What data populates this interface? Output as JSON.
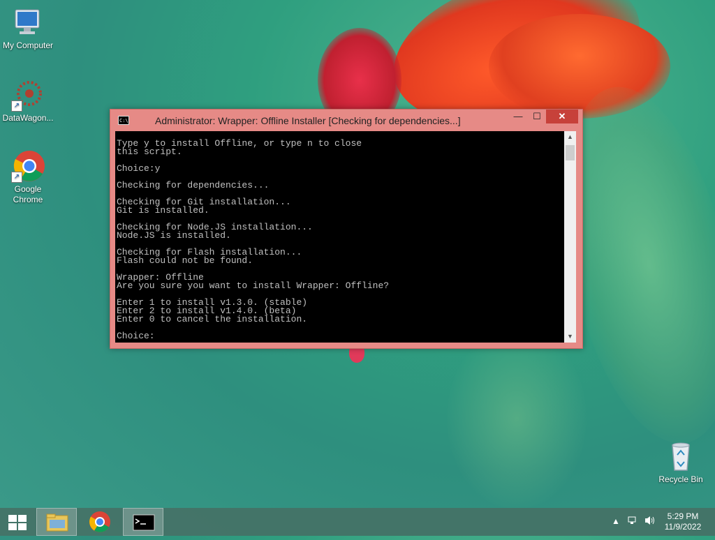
{
  "desktop": {
    "icons": [
      {
        "label": "My Computer",
        "icon": "computer-icon"
      },
      {
        "label": "DataWagon...",
        "icon": "datawagon-icon"
      },
      {
        "label": "Google Chrome",
        "icon": "chrome-icon"
      },
      {
        "label": "Recycle Bin",
        "icon": "recycle-bin-icon"
      }
    ]
  },
  "window": {
    "title": "Administrator:  Wrapper: Offline Installer [Checking for dependencies...]",
    "minimize_glyph": "—",
    "maximize_glyph": "☐",
    "close_glyph": "✕",
    "console_text": "Type y to install Offline, or type n to close\nthis script.\n\nChoice:y\n\nChecking for dependencies...\n\nChecking for Git installation...\nGit is installed.\n\nChecking for Node.JS installation...\nNode.JS is installed.\n\nChecking for Flash installation...\nFlash could not be found.\n\nWrapper: Offline\nAre you sure you want to install Wrapper: Offline?\n\nEnter 1 to install v1.3.0. (stable)\nEnter 2 to install v1.4.0. (beta)\nEnter 0 to cancel the installation.\n\nChoice:"
  },
  "taskbar": {
    "items": [
      "file-explorer-icon",
      "chrome-icon",
      "command-prompt-icon"
    ],
    "time": "5:29 PM",
    "date": "11/9/2022"
  },
  "colors": {
    "window_frame": "#e68a86",
    "close_button": "#c7413a",
    "console_bg": "#000000",
    "console_text": "#c0c0c0"
  }
}
